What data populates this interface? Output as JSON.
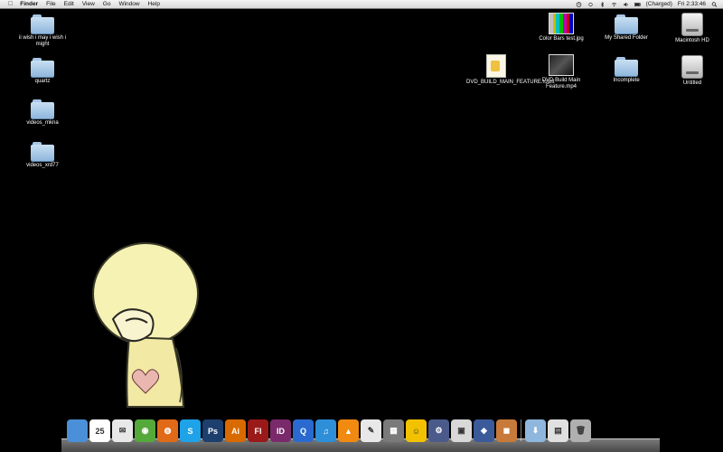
{
  "menubar": {
    "app": "Finder",
    "items": [
      "File",
      "Edit",
      "View",
      "Go",
      "Window",
      "Help"
    ],
    "status": {
      "battery": "(Charged)",
      "clock": "Fri 2:33:46"
    }
  },
  "desktop": {
    "left_icons": [
      {
        "label": "ii wish i may i wish i might",
        "kind": "folder"
      },
      {
        "label": "quartz",
        "kind": "folder"
      },
      {
        "label": "videos_mkna",
        "kind": "folder"
      },
      {
        "label": "videos_xrd77",
        "kind": "folder"
      }
    ],
    "right_icons": [
      {
        "label": "Color Bars test.jpg",
        "kind": "image"
      },
      {
        "label": "My Shared Folder",
        "kind": "folder"
      },
      {
        "label": "Macintosh HD",
        "kind": "drive"
      },
      {
        "label": "DVD_BUILD_MAIN_FEATURE.toast",
        "kind": "document"
      },
      {
        "label": "DVD Build Main Feature.mp4",
        "kind": "video"
      },
      {
        "label": "Incomplete",
        "kind": "folder"
      },
      {
        "label": "Untitled",
        "kind": "drive"
      }
    ]
  },
  "dock": {
    "items": [
      {
        "name": "finder",
        "glyph": "",
        "color": "#4a8fd8"
      },
      {
        "name": "ical",
        "glyph": "25",
        "color": "#ffffff"
      },
      {
        "name": "mail",
        "glyph": "✉",
        "color": "#e8e8e8"
      },
      {
        "name": "dashboard",
        "glyph": "◉",
        "color": "#55a83a"
      },
      {
        "name": "firefox",
        "glyph": "◍",
        "color": "#e06a18"
      },
      {
        "name": "skype",
        "glyph": "S",
        "color": "#1ea2e8"
      },
      {
        "name": "photoshop",
        "glyph": "Ps",
        "color": "#1c3f6e"
      },
      {
        "name": "illustrator",
        "glyph": "Ai",
        "color": "#d86a00"
      },
      {
        "name": "flash",
        "glyph": "Fl",
        "color": "#9a1a1a"
      },
      {
        "name": "indesign",
        "glyph": "ID",
        "color": "#7a2a6a"
      },
      {
        "name": "quicktime",
        "glyph": "Q",
        "color": "#2a6ad0"
      },
      {
        "name": "itunes",
        "glyph": "♫",
        "color": "#2e8fd8"
      },
      {
        "name": "vlc",
        "glyph": "▲",
        "color": "#f08a10"
      },
      {
        "name": "textedit",
        "glyph": "✎",
        "color": "#e8e8e8"
      },
      {
        "name": "activity-monitor",
        "glyph": "▦",
        "color": "#7a7a7a"
      },
      {
        "name": "adium",
        "glyph": "☺",
        "color": "#f2c200"
      },
      {
        "name": "system-preferences",
        "glyph": "⚙",
        "color": "#4a5a8a"
      },
      {
        "name": "preview",
        "glyph": "▣",
        "color": "#d8d8d8"
      },
      {
        "name": "cyberduck",
        "glyph": "◆",
        "color": "#3a5a9a"
      },
      {
        "name": "toast",
        "glyph": "◼",
        "color": "#c87a3a"
      },
      {
        "name": "downloads-folder",
        "glyph": "⬇",
        "color": "#8fb6dc"
      },
      {
        "name": "documents-stack",
        "glyph": "▤",
        "color": "#e0e0e0"
      },
      {
        "name": "trash",
        "glyph": "🗑",
        "color": "#b0b0b0"
      }
    ]
  }
}
